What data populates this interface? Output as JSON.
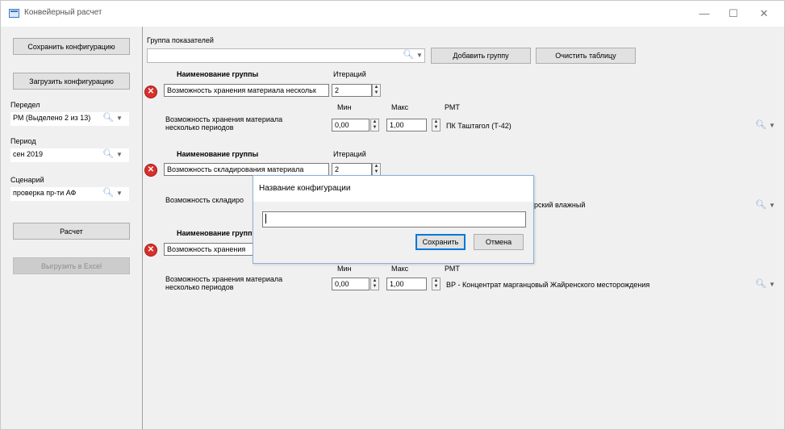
{
  "window": {
    "title": "Конвейерный расчет",
    "controls": {
      "minimize": "—",
      "maximize": "☐",
      "close": "✕"
    }
  },
  "sidebar": {
    "save_config": "Сохранить конфигурацию",
    "load_config": "Загрузить конфигурацию",
    "peredel_label": "Передел",
    "peredel_value": "РМ (Выделено 2 из 13)",
    "period_label": "Период",
    "period_value": "сен 2019",
    "scenario_label": "Сценарий",
    "scenario_value": "проверка пр-ти АФ",
    "calc_button": "Расчет",
    "export_button": "Выгрузить в Excel"
  },
  "toolbar": {
    "group_label": "Группа показателей",
    "group_input_value": "",
    "add_group": "Добавить группу",
    "clear_table": "Очистить таблицу"
  },
  "common": {
    "group_name_header": "Наименование группы",
    "iterations_header": "Итераций",
    "min_header": "Мин",
    "max_header": "Макс",
    "rmt_header": "РМТ",
    "indicator_line1": "Возможность хранения материала",
    "indicator_line2": "несколько периодов"
  },
  "groups": [
    {
      "name": "Возможность хранения материала нескольк",
      "iterations": "2",
      "indicator": "Возможность хранения материала несколько периодов",
      "min": "0,00",
      "max": "1,00",
      "rmt": "ПК Таштагол (Т-42)"
    },
    {
      "name": "Возможность складирования материала",
      "iterations": "2",
      "indicator": "Возможность складиро",
      "rmt": "торский влажный"
    },
    {
      "name": "Возможность хранения",
      "header_partial": "Наименование групп",
      "min": "0,00",
      "max": "1,00",
      "rmt": "ВР - Концентрат марганцовый Жайренского месторождения"
    }
  ],
  "dialog": {
    "title": "Название конфигурации",
    "input_value": "",
    "save": "Сохранить",
    "cancel": "Отмена"
  },
  "icons": {
    "search": "search-icon",
    "dropdown": "chevron-down-icon",
    "delete": "delete-circle-icon",
    "spin": "spin-updown-icon"
  },
  "colors": {
    "delete_red": "#d9302b",
    "dialog_border": "#8cb0da",
    "search_blue": "#7a9ed3",
    "focus_blue": "#0078d7"
  }
}
